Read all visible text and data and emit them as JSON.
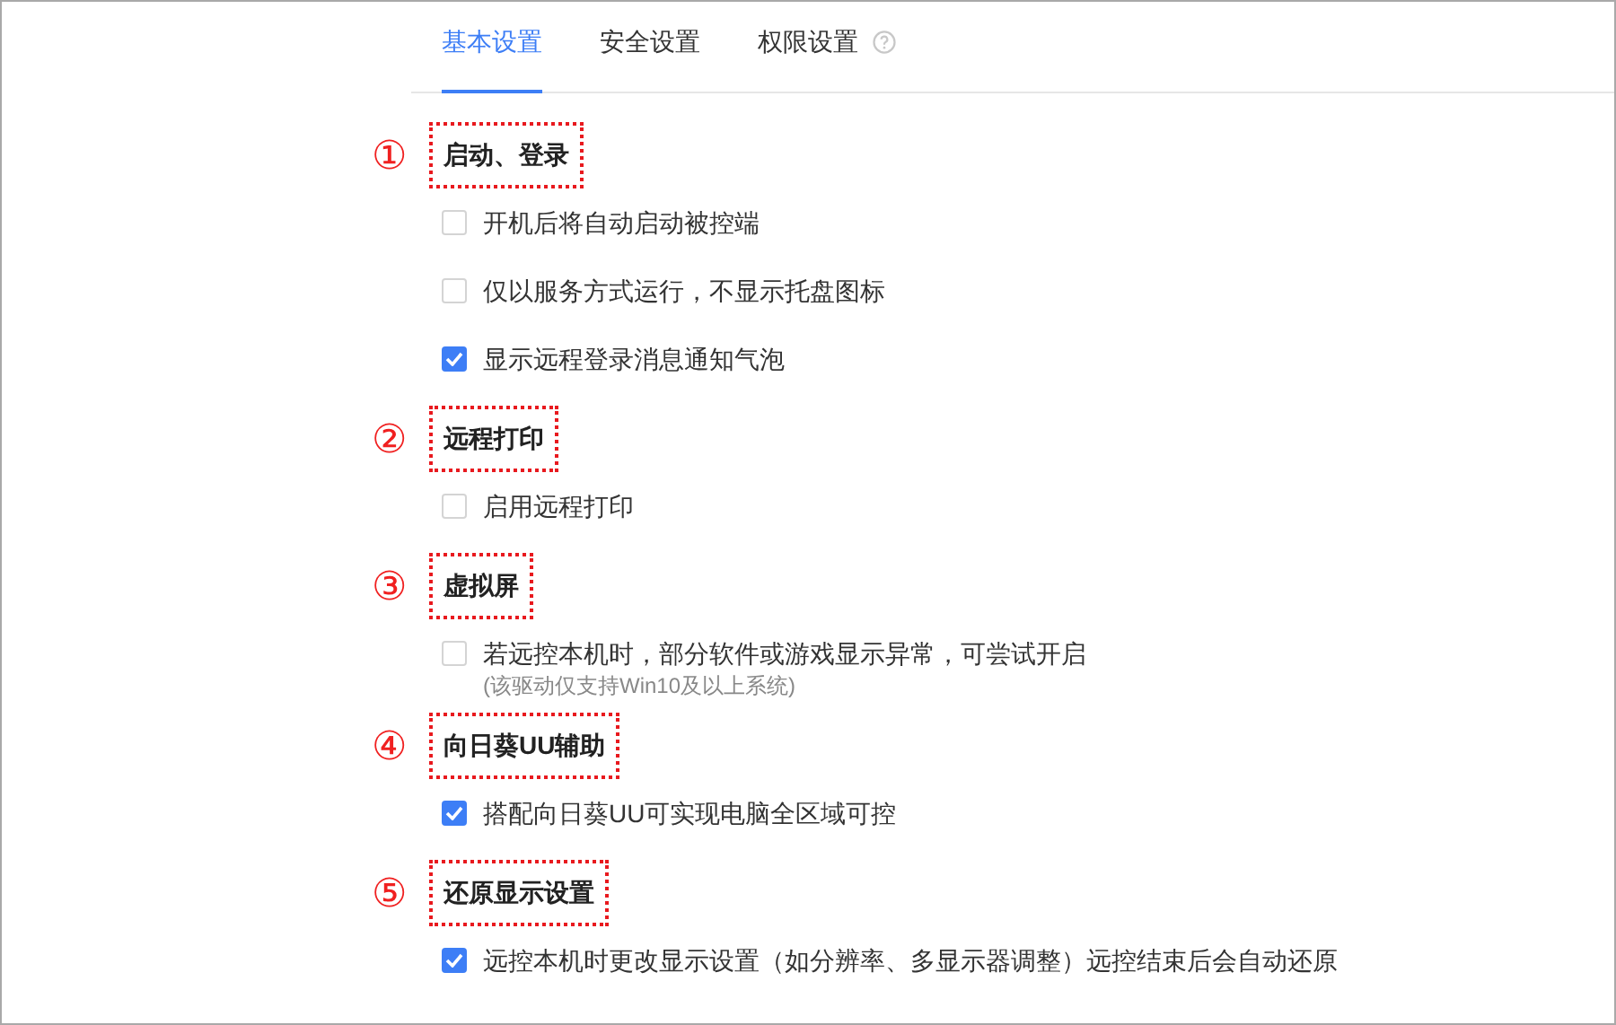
{
  "tabs": [
    {
      "label": "基本设置",
      "selected": true,
      "help": false
    },
    {
      "label": "安全设置",
      "selected": false,
      "help": false
    },
    {
      "label": "权限设置",
      "selected": false,
      "help": true
    }
  ],
  "sections": [
    {
      "marker": "①",
      "title": "启动、登录",
      "options": [
        {
          "label": "开机后将自动启动被控端",
          "checked": false
        },
        {
          "label": "仅以服务方式运行，不显示托盘图标",
          "checked": false
        },
        {
          "label": "显示远程登录消息通知气泡",
          "checked": true
        }
      ]
    },
    {
      "marker": "②",
      "title": "远程打印",
      "options": [
        {
          "label": "启用远程打印",
          "checked": false
        }
      ]
    },
    {
      "marker": "③",
      "title": "虚拟屏",
      "options": [
        {
          "label": "若远控本机时，部分软件或游戏显示异常，可尝试开启",
          "checked": false,
          "note": "(该驱动仅支持Win10及以上系统)"
        }
      ]
    },
    {
      "marker": "④",
      "title": "向日葵UU辅助",
      "options": [
        {
          "label": "搭配向日葵UU可实现电脑全区域可控",
          "checked": true
        }
      ]
    },
    {
      "marker": "⑤",
      "title": "还原显示设置",
      "options": [
        {
          "label": "远控本机时更改显示设置（如分辨率、多显示器调整）远控结束后会自动还原",
          "checked": true
        }
      ]
    }
  ]
}
